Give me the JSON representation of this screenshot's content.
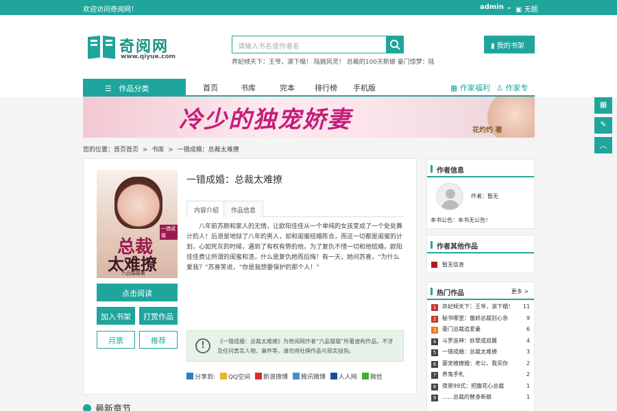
{
  "topbar": {
    "welcome": "欢迎访问奇阅网！",
    "user": "admin",
    "logout": "无题"
  },
  "logo": {
    "name": "奇阅网",
    "url": "www.qiyue.com"
  },
  "search": {
    "placeholder": "请输入书名或作者名",
    "hotwords": "弃妃倾天下：王爷，滚下榻！  陆婉风灵！  总裁的100天新娘  豪门惊梦：陆"
  },
  "shelf_button": "我的书架",
  "nav": {
    "category": "作品分类",
    "items": [
      "首页",
      "书库",
      "完本",
      "排行榜",
      "手机版"
    ],
    "right": [
      "作家福利",
      "作家专区"
    ]
  },
  "banner": {
    "title": "冷少的独宠娇妻",
    "author": "花灼灼 著"
  },
  "breadcrumb": [
    "您的位置：首页首页",
    ">",
    "书库",
    ">",
    "一错成婚：总裁太难撩"
  ],
  "book": {
    "title": "一错成婚：总裁太难撩",
    "cover_title_1": "总裁",
    "cover_title_2": "太难撩",
    "cover_small": "一错成婚",
    "cover_author": "六品猫猫著",
    "tabs": [
      "内容介绍",
      "作品信息"
    ],
    "intro": "八年前苏颜和家人的无情，让欧阳佳佳从一个单纯的女孩变成了一个处处算计的人！后退是地狱了八年的男人，却和闺蜜结婚陈合，而这一切都是闺蜜的计划，心如死灰的时候，遇到了有权有势的他，为了复仇不惜一切和他结婚。欧阳佳佳费让所谓的闺蜜和渣，什么是复仇她而后悔！有一天，她问苏喜，“为什么爱我？”苏喜笑说，“你是我想要保护的那个人！”",
    "notice": "《一错成婚：总裁太难撩》为奇阅网作者“六品猫猫”所著虚构作品，不涉及任何真实人物、事件等，请勿将杜撰作品与现实挂钩。",
    "buttons": {
      "read": "点击阅读",
      "add_shelf": "加入书架",
      "reward": "打赏作品",
      "monthly": "月票",
      "recommend": "推荐"
    },
    "share_label": "分享到:",
    "share_sites": [
      "QQ空间",
      "新浪微博",
      "腾讯微博",
      "人人网",
      "微信"
    ]
  },
  "latest_chapters": "最新章节",
  "author_panel": {
    "header": "作者信息",
    "author": "作者：暂无",
    "notice": "本书公告：本书无公告！"
  },
  "other_works": {
    "header": "作者其他作品",
    "items": [
      "暂无信息"
    ]
  },
  "hot_works": {
    "header": "热门作品",
    "more": "更多 >",
    "items": [
      {
        "rank": "1",
        "title": "弃妃倾天下：王爷，滚下榻！",
        "count": "11"
      },
      {
        "rank": "2",
        "title": "秘书哪里：傲娇总裁别心急",
        "count": "9"
      },
      {
        "rank": "3",
        "title": "豪门总裁追爱妻",
        "count": "6"
      },
      {
        "rank": "4",
        "title": "斗罗巫神：妖孽成双翼",
        "count": "4"
      },
      {
        "rank": "5",
        "title": "一错成婚：总裁太难撩",
        "count": "3"
      },
      {
        "rank": "6",
        "title": "豪宠撩撩婚：老公，我买你",
        "count": "2"
      },
      {
        "rank": "7",
        "title": "养鬼手札",
        "count": "2"
      },
      {
        "rank": "8",
        "title": "夜景99式：把腹花心总裁",
        "count": "1"
      },
      {
        "rank": "9",
        "title": "……总裁的替身新娘",
        "count": "1"
      }
    ]
  },
  "colors": {
    "accent": "#1fa59b",
    "rank_red": "#c0392b",
    "rank_orange": "#e67e22"
  }
}
